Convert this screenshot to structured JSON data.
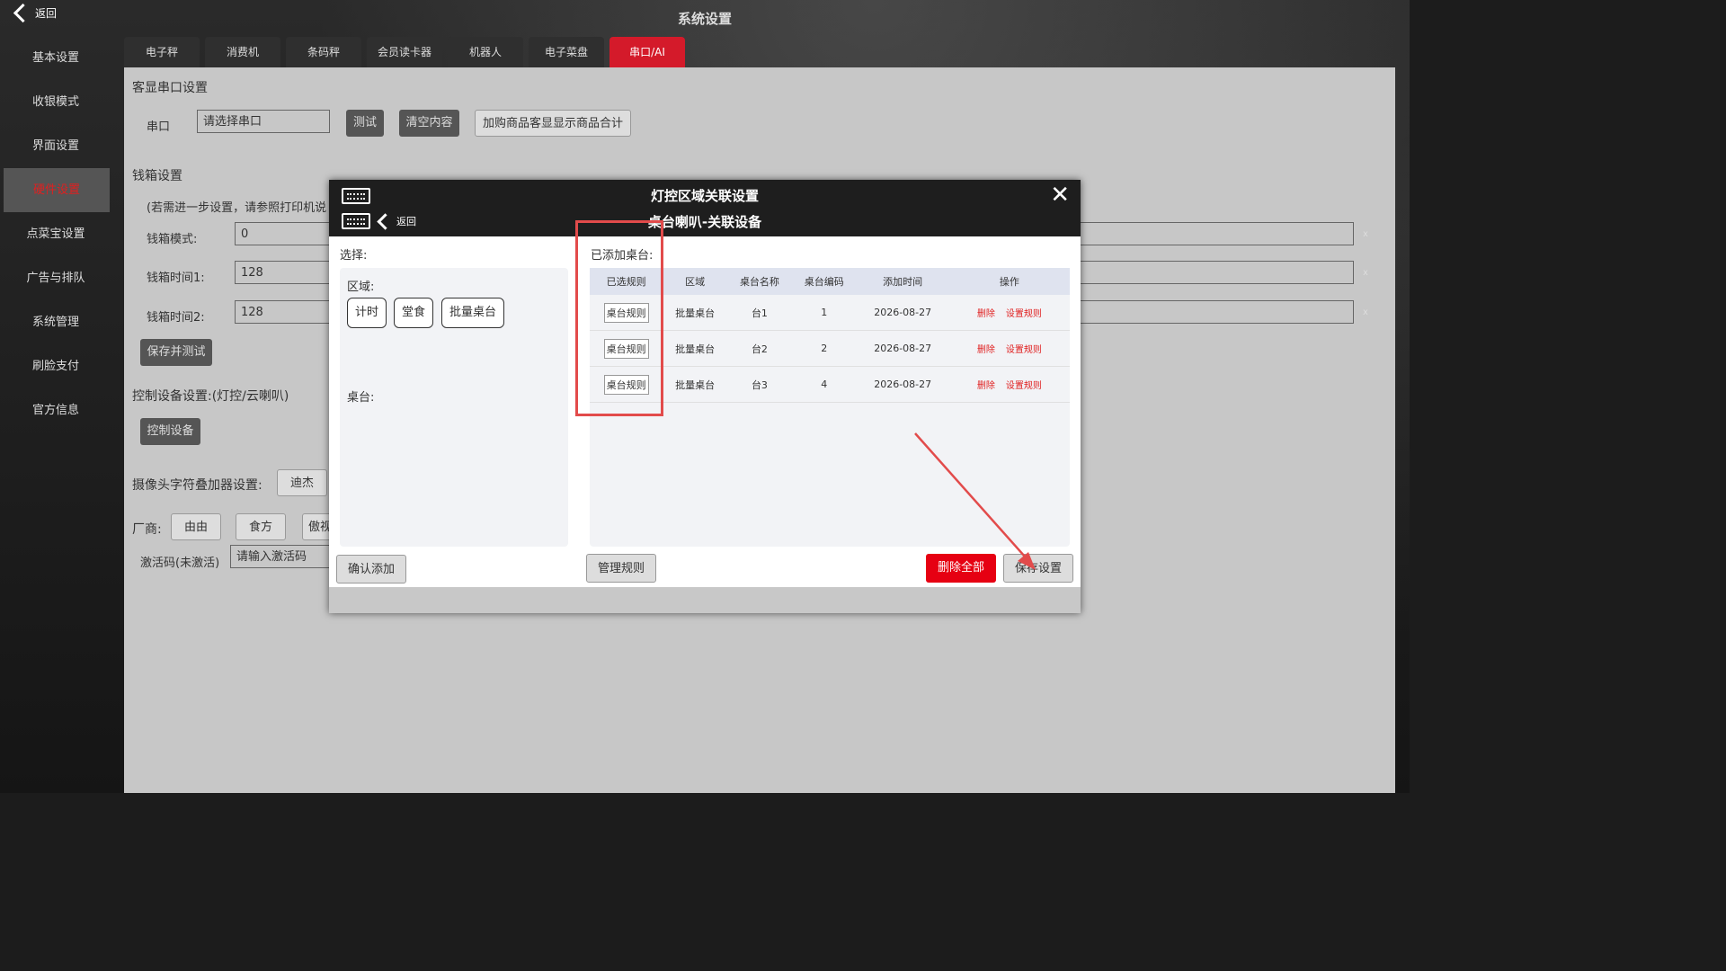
{
  "header": {
    "back_label": "返回",
    "title": "系统设置"
  },
  "sidebar": {
    "items": [
      {
        "label": "基本设置"
      },
      {
        "label": "收银模式"
      },
      {
        "label": "界面设置"
      },
      {
        "label": "硬件设置",
        "active": true
      },
      {
        "label": "点菜宝设置"
      },
      {
        "label": "广告与排队"
      },
      {
        "label": "系统管理"
      },
      {
        "label": "刷脸支付"
      },
      {
        "label": "官方信息"
      }
    ]
  },
  "tabs": [
    {
      "label": "电子秤"
    },
    {
      "label": "消费机"
    },
    {
      "label": "条码秤"
    },
    {
      "label": "会员读卡器"
    },
    {
      "label": "机器人"
    },
    {
      "label": "电子菜盘"
    },
    {
      "label": "串口/AI",
      "active": true
    }
  ],
  "main": {
    "customer_display": {
      "title": "客显串口设置",
      "port_label": "串口",
      "port_value": "请选择串口",
      "test_button": "测试",
      "clear_button": "清空内容",
      "sum_select": "加购商品客显显示商品合计"
    },
    "cash_drawer": {
      "title": "钱箱设置",
      "note": "(若需进一步设置，请参照打印机说",
      "mode_label": "钱箱模式:",
      "mode_value": "0",
      "time1_label": "钱箱时间1:",
      "time1_value": "128",
      "time2_label": "钱箱时间2:",
      "time2_value": "128",
      "save_test_button": "保存并测试"
    },
    "control_device": {
      "title": "控制设备设置:(灯控/云喇叭)",
      "button": "控制设备"
    },
    "camera_overlay": {
      "title": "摄像头字符叠加器设置:",
      "select_value": "迪杰"
    },
    "vendor": {
      "label": "厂商:",
      "options": [
        "由由",
        "食方",
        "傲视"
      ]
    },
    "activation": {
      "label": "激活码(未激活)",
      "placeholder": "请输入激活码"
    }
  },
  "modal": {
    "title": "灯控区域关联设置",
    "subtitle": "桌台喇叭-关联设备",
    "back_label": "返回",
    "close_symbol": "✕",
    "select_label": "选择:",
    "area_label": "区域:",
    "area_chips": [
      "计时",
      "堂食",
      "批量桌台"
    ],
    "table_label": "桌台:",
    "added_label": "已添加桌台:",
    "columns": [
      "已选规则",
      "区域",
      "桌台名称",
      "桌台编码",
      "添加时间",
      "操作"
    ],
    "rows": [
      {
        "rule": "桌台规则",
        "area": "批量桌台",
        "name": "台1",
        "code": "1",
        "time": "2026-08-27"
      },
      {
        "rule": "桌台规则",
        "area": "批量桌台",
        "name": "台2",
        "code": "2",
        "time": "2026-08-27"
      },
      {
        "rule": "桌台规则",
        "area": "批量桌台",
        "name": "台3",
        "code": "4",
        "time": "2026-08-27"
      }
    ],
    "delete_label": "删除",
    "set_rule_label": "设置规则",
    "confirm_add_button": "确认添加",
    "manage_rules_button": "管理规则",
    "delete_all_button": "删除全部",
    "save_button": "保存设置"
  },
  "colors": {
    "accent_red": "#e60012",
    "annotation_red": "#e24b4b"
  }
}
